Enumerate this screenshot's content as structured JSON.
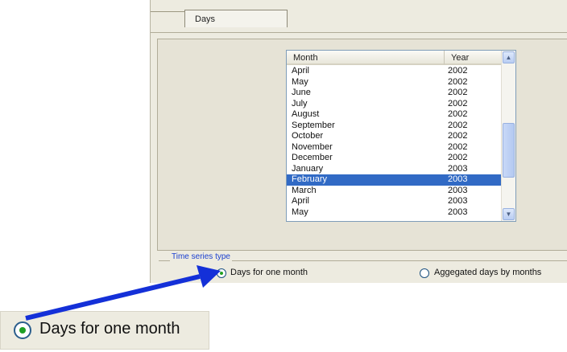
{
  "tabs": {
    "active_label": "Days"
  },
  "listview": {
    "columns": [
      "Month",
      "Year"
    ],
    "rows": [
      {
        "month": "April",
        "year": "2002"
      },
      {
        "month": "May",
        "year": "2002"
      },
      {
        "month": "June",
        "year": "2002"
      },
      {
        "month": "July",
        "year": "2002"
      },
      {
        "month": "August",
        "year": "2002"
      },
      {
        "month": "September",
        "year": "2002"
      },
      {
        "month": "October",
        "year": "2002"
      },
      {
        "month": "November",
        "year": "2002"
      },
      {
        "month": "December",
        "year": "2002"
      },
      {
        "month": "January",
        "year": "2003"
      },
      {
        "month": "February",
        "year": "2003",
        "selected": true
      },
      {
        "month": "March",
        "year": "2003"
      },
      {
        "month": "April",
        "year": "2003"
      },
      {
        "month": "May",
        "year": "2003"
      }
    ],
    "scroll_up_icon": "chevron-up-icon",
    "scroll_down_icon": "chevron-down-icon"
  },
  "time_series": {
    "group_label": "Time series type",
    "options": [
      {
        "label": "Days for one month",
        "checked": true
      },
      {
        "label": "Aggegated days by months",
        "checked": false
      }
    ]
  },
  "callout": {
    "label": "Days for one month",
    "arrow_color": "#1430d8"
  },
  "colors": {
    "selection": "#316ac5",
    "group_label": "#1a3fcf",
    "radio_dot": "#22a022"
  }
}
